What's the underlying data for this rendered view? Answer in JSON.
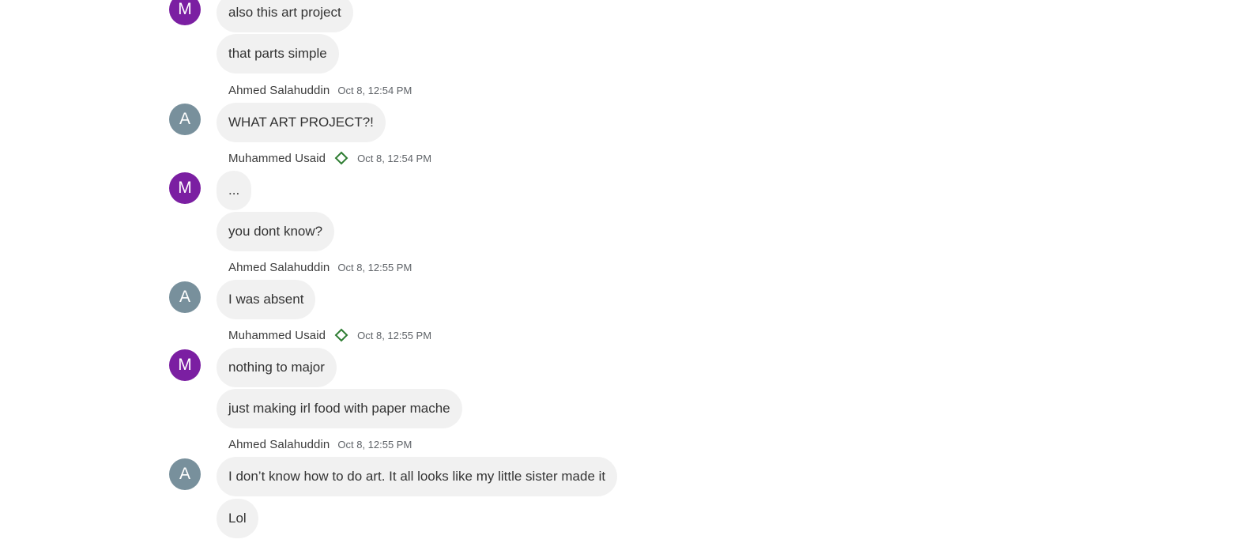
{
  "colors": {
    "avatar_m": "#7b1fa2",
    "avatar_a": "#78909c",
    "bubble_bg": "#f1f1f1",
    "badge": "#2e7d32"
  },
  "avatars": {
    "m": "M",
    "a": "A"
  },
  "badge_icon": "diamond-outline-icon",
  "messages": [
    {
      "text": "also this art project"
    },
    {
      "text": "that parts simple"
    },
    {
      "sender": "Ahmed Salahuddin",
      "time": "Oct 8, 12:54 PM",
      "text": "WHAT ART PROJECT?!"
    },
    {
      "sender": "Muhammed Usaid",
      "time": "Oct 8, 12:54 PM",
      "text": "..."
    },
    {
      "text": "you dont know?"
    },
    {
      "sender": "Ahmed Salahuddin",
      "time": "Oct 8, 12:55 PM",
      "text": "I was absent"
    },
    {
      "sender": "Muhammed Usaid",
      "time": "Oct 8, 12:55 PM",
      "text": "nothing to major"
    },
    {
      "text": "just making irl food with paper mache"
    },
    {
      "sender": "Ahmed Salahuddin",
      "time": "Oct 8, 12:55 PM",
      "text": "I don’t know how to do art. It all looks like my little sister made it"
    },
    {
      "text": "Lol"
    }
  ]
}
